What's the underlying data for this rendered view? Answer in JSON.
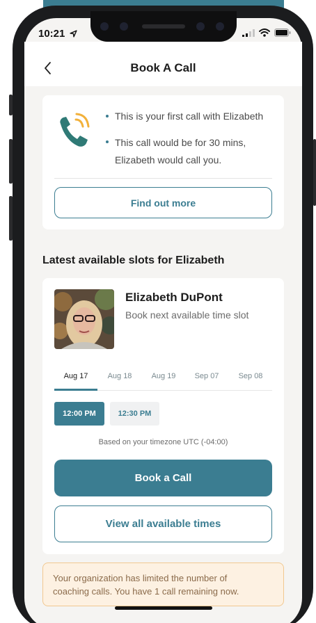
{
  "status_bar": {
    "time": "10:21"
  },
  "header": {
    "title": "Book A Call"
  },
  "info_card": {
    "bullets": [
      "This is your first call with Elizabeth",
      "This call would be for 30 mins,",
      "Elizabeth would call you."
    ],
    "find_out_more_label": "Find out more"
  },
  "slots_section": {
    "title": "Latest available slots for Elizabeth"
  },
  "coach": {
    "name": "Elizabeth DuPont",
    "subtitle": "Book next available time slot"
  },
  "date_tabs": [
    {
      "label": "Aug 17",
      "active": true
    },
    {
      "label": "Aug 18",
      "active": false
    },
    {
      "label": "Aug 19",
      "active": false
    },
    {
      "label": "Sep 07",
      "active": false
    },
    {
      "label": "Sep 08",
      "active": false
    }
  ],
  "time_slots": [
    {
      "label": "12:00 PM",
      "selected": true
    },
    {
      "label": "12:30 PM",
      "selected": false
    }
  ],
  "timezone_note": "Based on your timezone UTC (-04:00)",
  "book_button_label": "Book a Call",
  "view_all_label": "View all available times",
  "notice": {
    "line1": "Your organization has limited the number of",
    "line2": "coaching calls. You have 1 call remaining now."
  },
  "colors": {
    "accent": "#3b7d91",
    "notice_bg": "#fdf1e2",
    "notice_border": "#f1c890",
    "phone_icon": "#2f7a76",
    "ring_waves": "#f2b13b"
  },
  "icons": [
    "back-chevron-icon",
    "phone-ringing-icon",
    "location-arrow-icon",
    "signal-icon",
    "wifi-icon",
    "battery-icon"
  ]
}
